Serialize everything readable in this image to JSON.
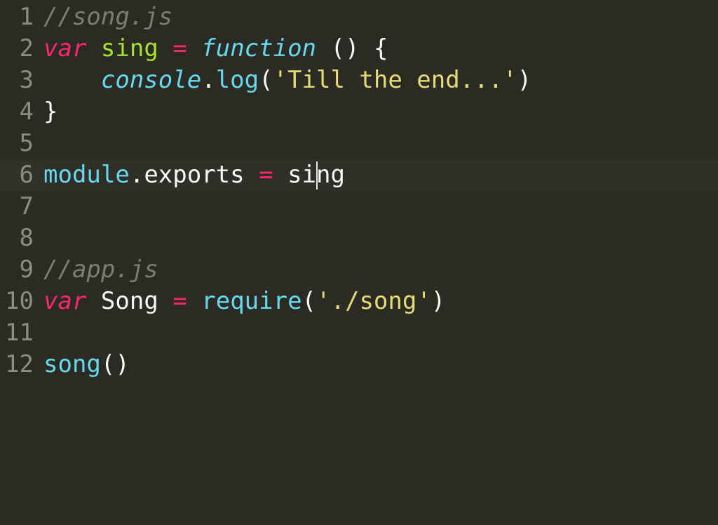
{
  "editor": {
    "cursor_line": 6,
    "lines": {
      "l1": {
        "num": "1",
        "comment": "//song.js"
      },
      "l2": {
        "num": "2",
        "var": "var",
        "name": "sing",
        "eq": "=",
        "fn": "function",
        "parens": "()",
        "brace": "{"
      },
      "l3": {
        "num": "3",
        "indent": "    ",
        "console": "console",
        "dot": ".",
        "log": "log",
        "open": "(",
        "str": "'Till the end...'",
        "close": ")"
      },
      "l4": {
        "num": "4",
        "brace": "}"
      },
      "l5": {
        "num": "5"
      },
      "l6": {
        "num": "6",
        "module": "module",
        "dot": ".",
        "exports": "exports",
        "eq": "=",
        "sing_a": "si",
        "sing_b": "ng"
      },
      "l7": {
        "num": "7"
      },
      "l8": {
        "num": "8"
      },
      "l9": {
        "num": "9",
        "comment": "//app.js"
      },
      "l10": {
        "num": "10",
        "var": "var",
        "name": "Song",
        "eq": "=",
        "require": "require",
        "open": "(",
        "str": "'./song'",
        "close": ")"
      },
      "l11": {
        "num": "11"
      },
      "l12": {
        "num": "12",
        "song": "song",
        "parens": "()"
      }
    }
  }
}
